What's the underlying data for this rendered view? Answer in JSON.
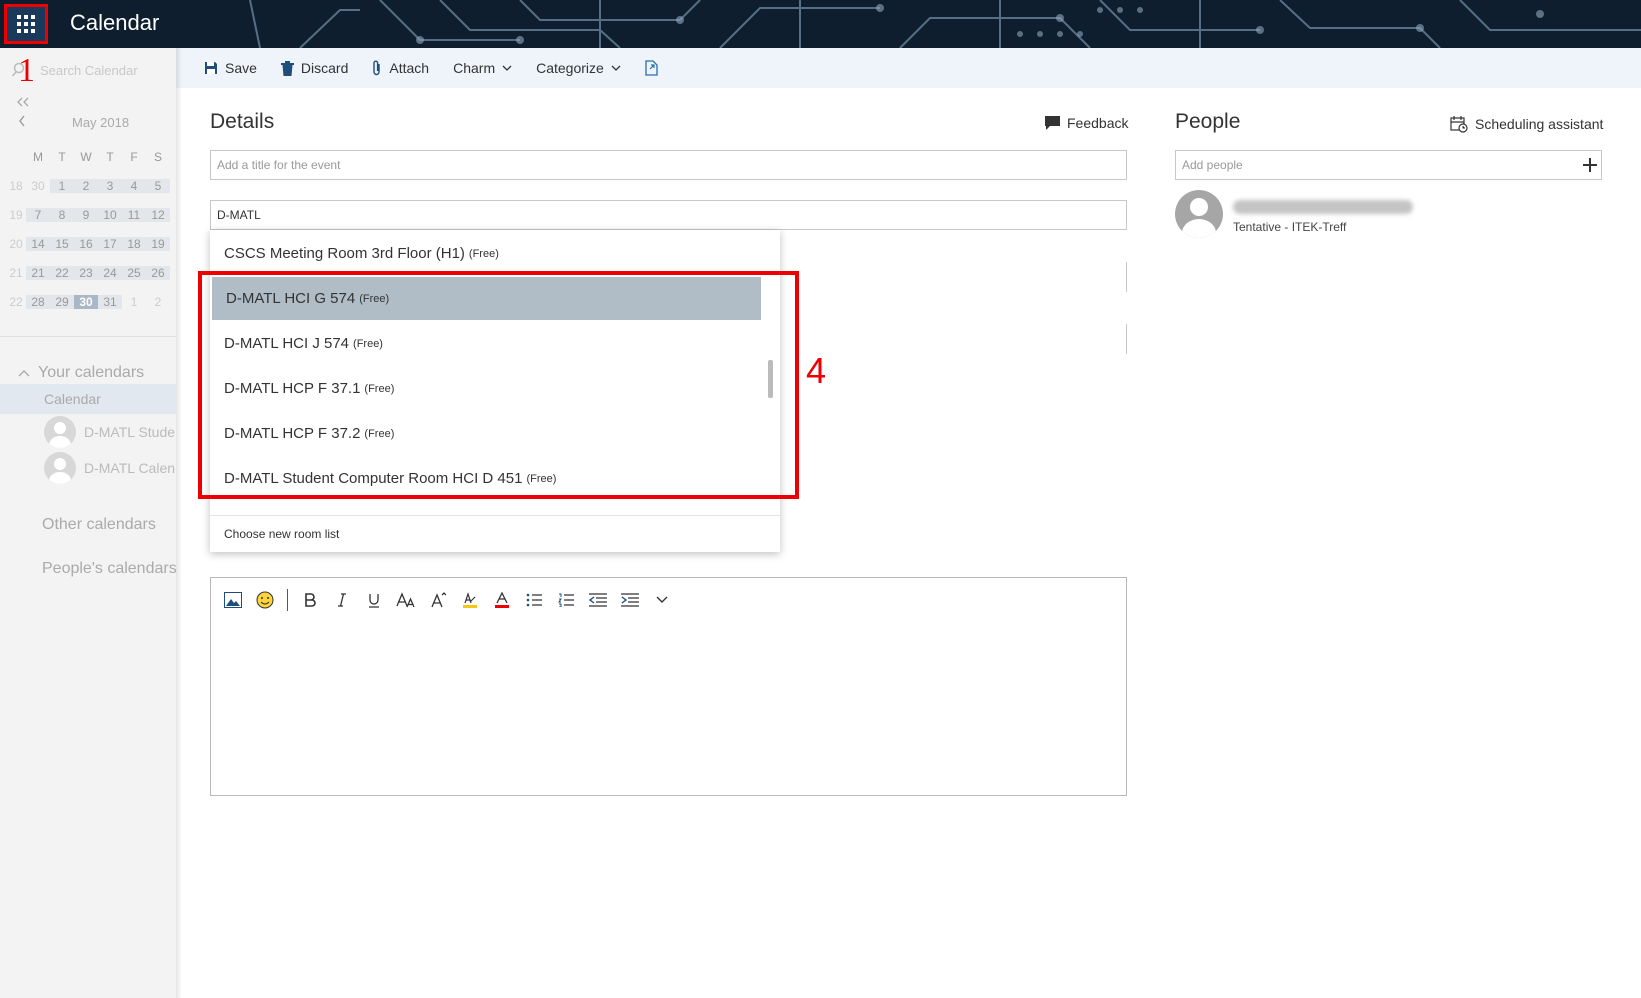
{
  "header": {
    "app_title": "Calendar"
  },
  "toolbar": {
    "save": "Save",
    "discard": "Discard",
    "attach": "Attach",
    "charm": "Charm",
    "categorize": "Categorize"
  },
  "sidebar": {
    "search_placeholder": "Search Calendar",
    "month_label": "May 2018",
    "weekdays": [
      "M",
      "T",
      "W",
      "T",
      "F",
      "S"
    ],
    "weeks": [
      {
        "week": "18",
        "days": [
          "30",
          "1",
          "2",
          "3",
          "4",
          "5"
        ]
      },
      {
        "week": "19",
        "days": [
          "7",
          "8",
          "9",
          "10",
          "11",
          "12"
        ]
      },
      {
        "week": "20",
        "days": [
          "14",
          "15",
          "16",
          "17",
          "18",
          "19"
        ]
      },
      {
        "week": "21",
        "days": [
          "21",
          "22",
          "23",
          "24",
          "25",
          "26"
        ]
      },
      {
        "week": "22",
        "days": [
          "28",
          "29",
          "30",
          "31",
          "1",
          "2"
        ]
      }
    ],
    "selected_day": "30",
    "your_calendars": "Your calendars",
    "calendar_item": "Calendar",
    "calendars": [
      "D-MATL Stude",
      "D-MATL Calen"
    ],
    "other_calendars": "Other calendars",
    "peoples_calendars": "People's calendars"
  },
  "details": {
    "title": "Details",
    "feedback": "Feedback",
    "title_placeholder": "Add a title for the event",
    "location_value": "D-MATL"
  },
  "room_dropdown": {
    "items": [
      {
        "name": "CSCS Meeting Room 3rd Floor (H1)",
        "status": "(Free)"
      },
      {
        "name": "D-MATL HCI G 574",
        "status": "(Free)"
      },
      {
        "name": "D-MATL HCI J 574",
        "status": "(Free)"
      },
      {
        "name": "D-MATL HCP F 37.1",
        "status": "(Free)"
      },
      {
        "name": "D-MATL HCP F 37.2",
        "status": "(Free)"
      },
      {
        "name": "D-MATL Student Computer Room HCI D 451",
        "status": "(Free)"
      }
    ],
    "highlighted_index": 1,
    "footer": "Choose new room list"
  },
  "annotations": {
    "step_one": "1",
    "step_four": "4"
  },
  "people": {
    "title": "People",
    "scheduling_assistant": "Scheduling assistant",
    "add_placeholder": "Add people",
    "attendee_status": "Tentative - ITEK-Treff"
  },
  "colors": {
    "highlight": "#b0bcc6",
    "annotation": "#ee0000",
    "header_bg": "#0e1e2e"
  }
}
